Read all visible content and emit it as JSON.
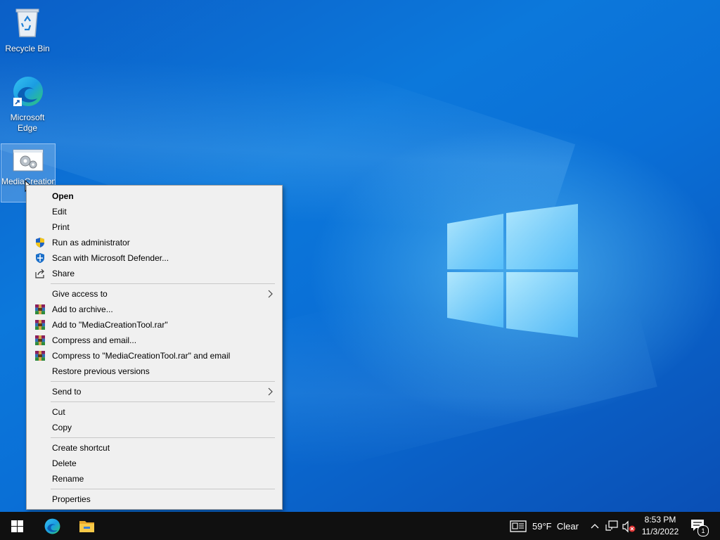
{
  "desktop": {
    "icons": [
      {
        "label": "Recycle Bin"
      },
      {
        "label": "Microsoft Edge"
      },
      {
        "label": "MediaCreationTool"
      }
    ]
  },
  "context_menu": {
    "items": [
      {
        "label": "Open"
      },
      {
        "label": "Edit"
      },
      {
        "label": "Print"
      },
      {
        "label": "Run as administrator"
      },
      {
        "label": "Scan with Microsoft Defender..."
      },
      {
        "label": "Share"
      },
      {
        "label": "Give access to"
      },
      {
        "label": "Add to archive..."
      },
      {
        "label": "Add to \"MediaCreationTool.rar\""
      },
      {
        "label": "Compress and email..."
      },
      {
        "label": "Compress to \"MediaCreationTool.rar\" and email"
      },
      {
        "label": "Restore previous versions"
      },
      {
        "label": "Send to"
      },
      {
        "label": "Cut"
      },
      {
        "label": "Copy"
      },
      {
        "label": "Create shortcut"
      },
      {
        "label": "Delete"
      },
      {
        "label": "Rename"
      },
      {
        "label": "Properties"
      }
    ]
  },
  "taskbar": {
    "weather": {
      "temperature": "59°F",
      "condition": "Clear"
    },
    "clock": {
      "time": "8:53 PM",
      "date": "11/3/2022"
    },
    "notification_count": "1"
  },
  "icons": {
    "start": "windows-logo-icon",
    "edge": "edge-icon",
    "explorer": "folder-icon",
    "shield": "uac-shield-icon",
    "defender": "defender-icon",
    "share": "share-icon",
    "winrar": "winrar-icon",
    "submenu": "chevron-right-icon"
  },
  "colors": {
    "menu_bg": "#f0f0f0",
    "taskbar_bg": "#101010",
    "desktop_blue": "#0a6fd6"
  }
}
